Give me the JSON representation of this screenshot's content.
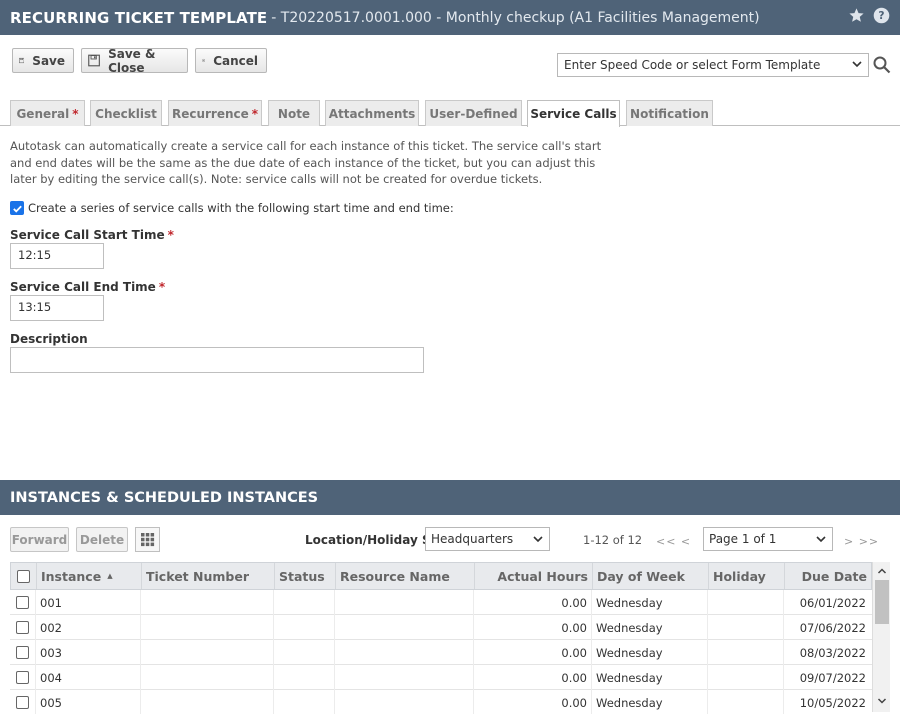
{
  "window": {
    "title": "RECURRING TICKET TEMPLATE",
    "subtitle": "- T20220517.0001.000 - Monthly checkup (A1 Facilities Management)",
    "icons": [
      "star-icon",
      "help-icon"
    ]
  },
  "toolbar": {
    "save_label": "Save",
    "save_close_label": "Save & Close",
    "cancel_label": "Cancel",
    "speed_code_placeholder": "Enter Speed Code or select Form Template"
  },
  "tabs": [
    {
      "label": "General",
      "required": "*",
      "active": false
    },
    {
      "label": "Checklist",
      "required": "",
      "active": false
    },
    {
      "label": "Recurrence",
      "required": "*",
      "active": false
    },
    {
      "label": "Note",
      "required": "",
      "active": false
    },
    {
      "label": "Attachments",
      "required": "",
      "active": false
    },
    {
      "label": "User-Defined",
      "required": "",
      "active": false
    },
    {
      "label": "Service Calls",
      "required": "",
      "active": true
    },
    {
      "label": "Notification",
      "required": "",
      "active": false
    }
  ],
  "service_calls": {
    "description": "Autotask can automatically create a service call for each instance of this ticket. The service call's start and end dates will be the same as the due date of each instance of the ticket, but you can adjust this later by editing the service call(s). Note: service calls will not be created for overdue tickets.",
    "create_series_label": "Create a series of service calls with the following start time and end time:",
    "create_series_checked": true,
    "start_time_label": "Service Call Start Time",
    "start_time_value": "12:15",
    "end_time_label": "Service Call End Time",
    "end_time_value": "13:15",
    "description_label": "Description",
    "description_value": "",
    "required_marker": "*"
  },
  "instances": {
    "section_title": "INSTANCES & SCHEDULED INSTANCES",
    "forward_label": "Forward",
    "delete_label": "Delete",
    "location_label": "Location/Holiday Set",
    "location_value": "Headquarters",
    "count_text": "1-12 of 12",
    "first_prev": "<<   <",
    "next_last": ">   >>",
    "page_value": "Page 1 of 1",
    "sort_indicator": "▲",
    "columns": [
      "Instance",
      "Ticket Number",
      "Status",
      "Resource Name",
      "Actual Hours",
      "Day of Week",
      "Holiday",
      "Due Date"
    ],
    "rows": [
      {
        "instance": "001",
        "ticket_number": "",
        "status": "",
        "resource": "",
        "hours": "0.00",
        "day": "Wednesday",
        "holiday": "",
        "due": "06/01/2022"
      },
      {
        "instance": "002",
        "ticket_number": "",
        "status": "",
        "resource": "",
        "hours": "0.00",
        "day": "Wednesday",
        "holiday": "",
        "due": "07/06/2022"
      },
      {
        "instance": "003",
        "ticket_number": "",
        "status": "",
        "resource": "",
        "hours": "0.00",
        "day": "Wednesday",
        "holiday": "",
        "due": "08/03/2022"
      },
      {
        "instance": "004",
        "ticket_number": "",
        "status": "",
        "resource": "",
        "hours": "0.00",
        "day": "Wednesday",
        "holiday": "",
        "due": "09/07/2022"
      },
      {
        "instance": "005",
        "ticket_number": "",
        "status": "",
        "resource": "",
        "hours": "0.00",
        "day": "Wednesday",
        "holiday": "",
        "due": "10/05/2022"
      }
    ]
  },
  "colors": {
    "header_bg": "#4f6378",
    "checkbox_accent": "#1a73e8",
    "required_red": "#c0272d"
  }
}
